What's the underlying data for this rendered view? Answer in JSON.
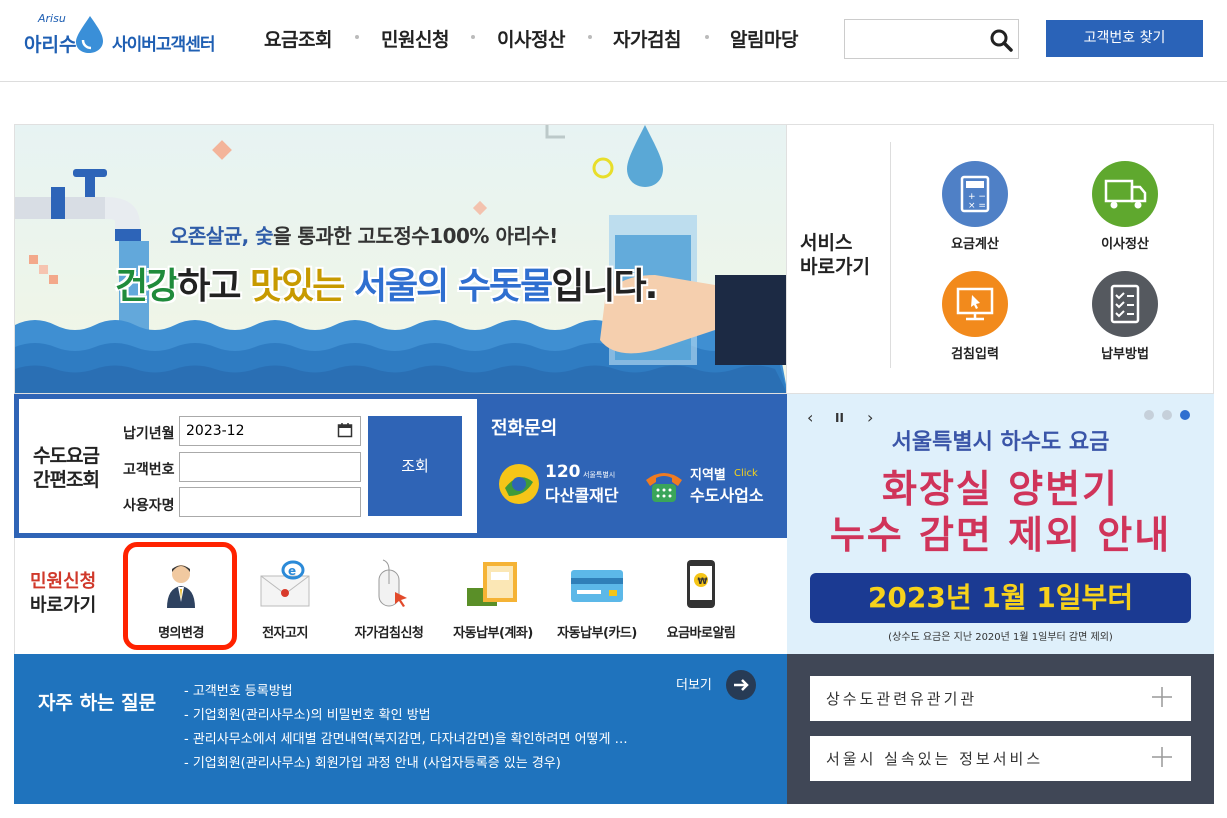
{
  "header": {
    "logo_small": "Arisu",
    "logo_brand": "아리수",
    "logo_sub": "사이버고객센터",
    "nav": [
      "요금조회",
      "민원신청",
      "이사정산",
      "자가검침",
      "알림마당"
    ],
    "search_placeholder": "",
    "find_button": "고객번호 찾기"
  },
  "banner": {
    "line1_blue": "오존살균, 숯",
    "line1_rest": "을 통과한 고도정수100% 아리수!",
    "line2_a": "건강",
    "line2_b": "하고 ",
    "line2_c": "맛있는",
    "line2_d": " 서울의 수돗물",
    "line2_e": "입니다."
  },
  "service": {
    "title_line1": "서비스",
    "title_line2": "바로가기",
    "items": [
      {
        "label": "요금계산",
        "icon": "calculator-icon",
        "color": "#4f80c6"
      },
      {
        "label": "이사정산",
        "icon": "truck-icon",
        "color": "#5fa82e"
      },
      {
        "label": "검침입력",
        "icon": "meter-input-icon",
        "color": "#f28a1c"
      },
      {
        "label": "납부방법",
        "icon": "checklist-icon",
        "color": "#55595f"
      }
    ]
  },
  "lookup": {
    "title_line1": "수도요금",
    "title_line2": "간편조회",
    "period_label": "납기년월",
    "period_value": "2023-12",
    "customer_label": "고객번호",
    "customer_value": "",
    "user_label": "사용자명",
    "user_value": "",
    "button": "조회"
  },
  "phone": {
    "title": "전화문의",
    "dasan_num": "120",
    "dasan_small": "서울특별시",
    "dasan_name": "다산콜재단",
    "region_top": "지역별",
    "region_click": "Click",
    "region_name": "수도사업소"
  },
  "civil": {
    "title_line1": "민원신청",
    "title_line2": "바로가기",
    "items": [
      {
        "label": "명의변경",
        "icon": "person-icon"
      },
      {
        "label": "전자고지",
        "icon": "email-notice-icon"
      },
      {
        "label": "자가검침신청",
        "icon": "mouse-icon"
      },
      {
        "label": "자동납부(계좌)",
        "icon": "bankbook-icon"
      },
      {
        "label": "자동납부(카드)",
        "icon": "card-icon"
      },
      {
        "label": "요금바로알림",
        "icon": "phone-alert-icon"
      }
    ]
  },
  "notice": {
    "prev": "‹",
    "pause": "II",
    "next": "›",
    "line1": "서울특별시 하수도 요금",
    "line2": "화장실 양변기",
    "line3": "누수 감면 제외 안내",
    "date_bar": "2023년 1월 1일부터",
    "footnote": "(상수도 요금은 지난 2020년 1월 1일부터 감면 제외)"
  },
  "faq": {
    "title": "자주 하는 질문",
    "more": "더보기",
    "items": [
      "- 고객번호 등록방법",
      "- 기업회원(관리사무소)의 비밀번호 확인 방법",
      "- 관리사무소에서 세대별 감면내역(복지감면, 다자녀감면)을 확인하려면 어떻게 …",
      "- 기업회원(관리사무소) 회원가입 과정 안내 (사업자등록증 있는 경우)"
    ]
  },
  "related": {
    "items": [
      "상수도관련유관기관",
      "서울시 실속있는 정보서비스"
    ]
  }
}
